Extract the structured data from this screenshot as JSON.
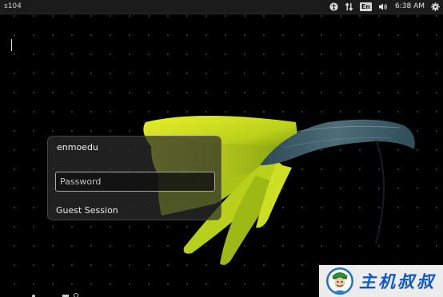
{
  "top_panel": {
    "hostname": "s104",
    "language_indicator": "En",
    "clock": "6:38 AM",
    "icons": [
      "accessibility-icon",
      "network-icon",
      "keyboard-language-icon",
      "volume-icon",
      "power-gear-icon"
    ]
  },
  "login": {
    "username": "enmoedu",
    "password_placeholder": "Password",
    "guest_session_label": "Guest Session"
  },
  "watermark": {
    "text": "主机叔叔"
  },
  "colors": {
    "background": "#000000",
    "panel": "#1b1b1b",
    "watermark_text": "#0d58c6",
    "flower_yellow": "#c9dc1a",
    "flower_stem": "#3a5a63"
  }
}
